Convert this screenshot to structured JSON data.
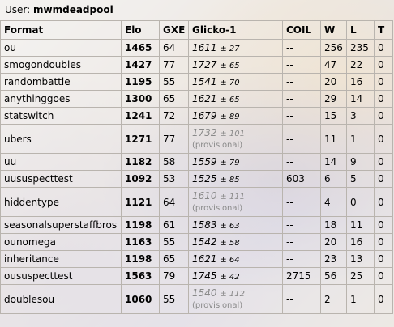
{
  "user": {
    "label": "User:",
    "name": "mwmdeadpool"
  },
  "columns": [
    "Format",
    "Elo",
    "GXE",
    "Glicko-1",
    "COIL",
    "W",
    "L",
    "T"
  ],
  "rows": [
    {
      "format": "ou",
      "elo": "1465",
      "gxe": "64",
      "glicko": "1611",
      "dev": "± 27",
      "provisional": "",
      "coil": "--",
      "w": "256",
      "l": "235",
      "t": "0"
    },
    {
      "format": "smogondoubles",
      "elo": "1427",
      "gxe": "77",
      "glicko": "1727",
      "dev": "± 65",
      "provisional": "",
      "coil": "--",
      "w": "47",
      "l": "22",
      "t": "0"
    },
    {
      "format": "randombattle",
      "elo": "1195",
      "gxe": "55",
      "glicko": "1541",
      "dev": "± 70",
      "provisional": "",
      "coil": "--",
      "w": "20",
      "l": "16",
      "t": "0"
    },
    {
      "format": "anythinggoes",
      "elo": "1300",
      "gxe": "65",
      "glicko": "1621",
      "dev": "± 65",
      "provisional": "",
      "coil": "--",
      "w": "29",
      "l": "14",
      "t": "0"
    },
    {
      "format": "statswitch",
      "elo": "1241",
      "gxe": "72",
      "glicko": "1679",
      "dev": "± 89",
      "provisional": "",
      "coil": "--",
      "w": "15",
      "l": "3",
      "t": "0"
    },
    {
      "format": "ubers",
      "elo": "1271",
      "gxe": "77",
      "glicko": "1732",
      "dev": "± 101",
      "provisional": "(provisional)",
      "coil": "--",
      "w": "11",
      "l": "1",
      "t": "0"
    },
    {
      "format": "uu",
      "elo": "1182",
      "gxe": "58",
      "glicko": "1559",
      "dev": "± 79",
      "provisional": "",
      "coil": "--",
      "w": "14",
      "l": "9",
      "t": "0"
    },
    {
      "format": "uususpecttest",
      "elo": "1092",
      "gxe": "53",
      "glicko": "1525",
      "dev": "± 85",
      "provisional": "",
      "coil": "603",
      "w": "6",
      "l": "5",
      "t": "0"
    },
    {
      "format": "hiddentype",
      "elo": "1121",
      "gxe": "64",
      "glicko": "1610",
      "dev": "± 111",
      "provisional": "(provisional)",
      "coil": "--",
      "w": "4",
      "l": "0",
      "t": "0"
    },
    {
      "format": "seasonalsuperstaffbros",
      "elo": "1198",
      "gxe": "61",
      "glicko": "1583",
      "dev": "± 63",
      "provisional": "",
      "coil": "--",
      "w": "18",
      "l": "11",
      "t": "0"
    },
    {
      "format": "ounomega",
      "elo": "1163",
      "gxe": "55",
      "glicko": "1542",
      "dev": "± 58",
      "provisional": "",
      "coil": "--",
      "w": "20",
      "l": "16",
      "t": "0"
    },
    {
      "format": "inheritance",
      "elo": "1198",
      "gxe": "65",
      "glicko": "1621",
      "dev": "± 64",
      "provisional": "",
      "coil": "--",
      "w": "23",
      "l": "13",
      "t": "0"
    },
    {
      "format": "oususpecttest",
      "elo": "1563",
      "gxe": "79",
      "glicko": "1745",
      "dev": "± 42",
      "provisional": "",
      "coil": "2715",
      "w": "56",
      "l": "25",
      "t": "0"
    },
    {
      "format": "doublesou",
      "elo": "1060",
      "gxe": "55",
      "glicko": "1540",
      "dev": "± 112",
      "provisional": "(provisional)",
      "coil": "--",
      "w": "2",
      "l": "1",
      "t": "0"
    }
  ]
}
